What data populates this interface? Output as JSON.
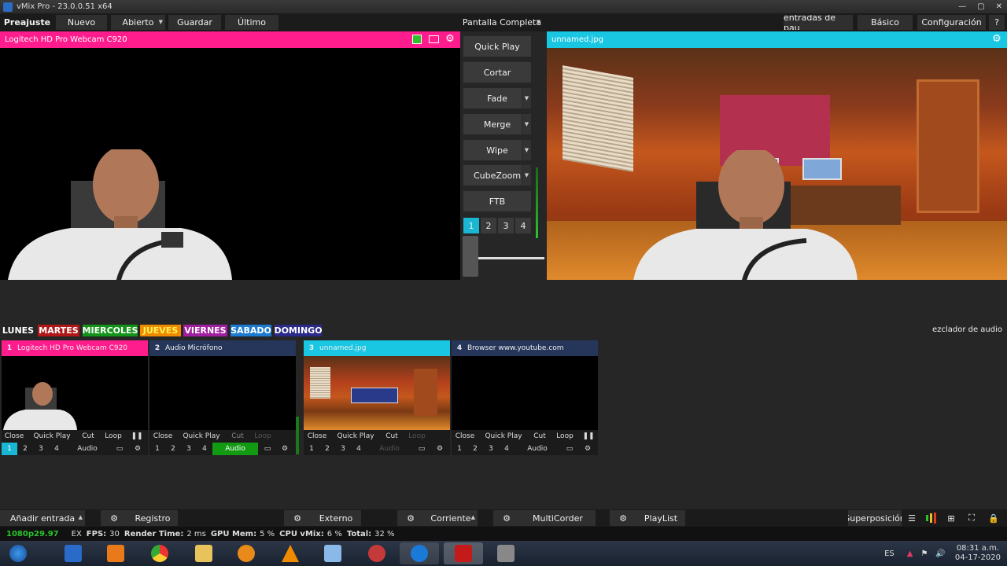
{
  "window": {
    "title": "vMix Pro - 23.0.0.51 x64",
    "controls": [
      "—",
      "▢",
      "✕"
    ]
  },
  "menu": {
    "preview_label": "Preajuste",
    "new_label": "Nuevo",
    "open_label": "Abierto",
    "save_label": "Guardar",
    "last_label": "Último",
    "fullscreen_label": "Pantalla Completa",
    "inputs_label": "entradas de pau",
    "basic_label": "Básico",
    "config_label": "Configuración",
    "help_label": "?"
  },
  "preview": {
    "title": "Logitech HD Pro Webcam C920",
    "accent": "#ff1c8d"
  },
  "output": {
    "title": "unnamed.jpg",
    "accent": "#19c7e3"
  },
  "transitions": {
    "quick_play": "Quick Play",
    "cut": "Cortar",
    "fade": "Fade",
    "merge": "Merge",
    "wipe": "Wipe",
    "cubezoom": "CubeZoom",
    "ftb": "FTB",
    "numbers": [
      "1",
      "2",
      "3",
      "4"
    ],
    "selected": "1"
  },
  "tags": [
    {
      "label": "LUNES",
      "bg": "#262626",
      "fg": "#ffffff"
    },
    {
      "label": "MARTES",
      "bg": "#b01818",
      "fg": "#ffffff"
    },
    {
      "label": "MIERCOLES",
      "bg": "#13931a",
      "fg": "#ffffff"
    },
    {
      "label": "JUEVES",
      "bg": "#f08a00",
      "fg": "#fff35a"
    },
    {
      "label": "VIERNES",
      "bg": "#a01ea0",
      "fg": "#ffffff"
    },
    {
      "label": "SABADO",
      "bg": "#1c7ad0",
      "fg": "#ffffff"
    },
    {
      "label": "DOMINGO",
      "bg": "#2a2a8a",
      "fg": "#ffffff"
    }
  ],
  "audio_mixer_label": "ezclador de audio",
  "inputs": [
    {
      "num": "1",
      "title": "Logitech HD Pro Webcam C920",
      "head_bg": "#ff1c8d",
      "num_bg": "#ff1c8d",
      "close": "Close",
      "quick_play": "Quick Play",
      "cut": "Cut",
      "loop": "Loop",
      "audio": "Audio",
      "nums": [
        "1",
        "2",
        "3",
        "4"
      ]
    },
    {
      "num": "2",
      "title": "Audio Micrófono",
      "head_bg": "#26365a",
      "num_bg": "#26365a",
      "close": "Close",
      "quick_play": "Quick Play",
      "cut": "Cut",
      "loop": "Loop",
      "audio": "Audio",
      "nums": [
        "1",
        "2",
        "3",
        "4"
      ]
    },
    {
      "num": "3",
      "title": "unnamed.jpg",
      "head_bg": "#19c7e3",
      "num_bg": "#19c7e3",
      "close": "Close",
      "quick_play": "Quick Play",
      "cut": "Cut",
      "loop": "Loop",
      "audio": "Audio",
      "nums": [
        "1",
        "2",
        "3",
        "4"
      ]
    },
    {
      "num": "4",
      "title": "Browser www.youtube.com",
      "head_bg": "#26365a",
      "num_bg": "#26365a",
      "close": "Close",
      "quick_play": "Quick Play",
      "cut": "Cut",
      "loop": "Loop",
      "audio": "Audio",
      "nums": [
        "1",
        "2",
        "3",
        "4"
      ]
    }
  ],
  "bottom": {
    "add_input": "Añadir entrada",
    "log": "Registro",
    "external": "Externo",
    "stream": "Corriente",
    "multicorder": "MultiCorder",
    "playlist": "PlayList",
    "overlay": "Superposición"
  },
  "status": {
    "format": "1080p29.97",
    "ex": "EX",
    "fps_label": "FPS:",
    "fps": "30",
    "render_label": "Render Time:",
    "render": "2 ms",
    "gpu_label": "GPU Mem:",
    "gpu": "5 %",
    "cpu_label": "CPU vMix:",
    "cpu": "6 %",
    "total_label": "Total:",
    "total": "32 %"
  },
  "taskbar": {
    "lang": "ES",
    "time": "08:31 a.m.",
    "date": "04-17-2020"
  }
}
